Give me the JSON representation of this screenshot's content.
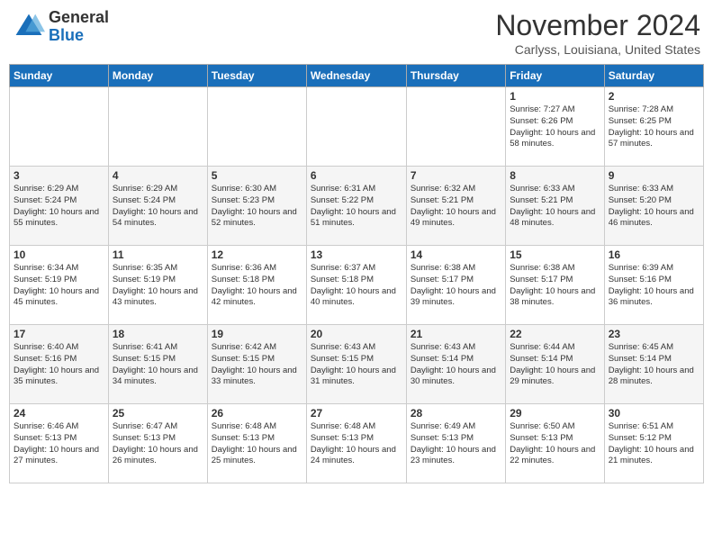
{
  "header": {
    "logo": {
      "line1": "General",
      "line2": "Blue"
    },
    "month": "November 2024",
    "location": "Carlyss, Louisiana, United States"
  },
  "weekdays": [
    "Sunday",
    "Monday",
    "Tuesday",
    "Wednesday",
    "Thursday",
    "Friday",
    "Saturday"
  ],
  "weeks": [
    [
      {
        "day": "",
        "info": ""
      },
      {
        "day": "",
        "info": ""
      },
      {
        "day": "",
        "info": ""
      },
      {
        "day": "",
        "info": ""
      },
      {
        "day": "",
        "info": ""
      },
      {
        "day": "1",
        "info": "Sunrise: 7:27 AM\nSunset: 6:26 PM\nDaylight: 10 hours and 58 minutes."
      },
      {
        "day": "2",
        "info": "Sunrise: 7:28 AM\nSunset: 6:25 PM\nDaylight: 10 hours and 57 minutes."
      }
    ],
    [
      {
        "day": "3",
        "info": "Sunrise: 6:29 AM\nSunset: 5:24 PM\nDaylight: 10 hours and 55 minutes."
      },
      {
        "day": "4",
        "info": "Sunrise: 6:29 AM\nSunset: 5:24 PM\nDaylight: 10 hours and 54 minutes."
      },
      {
        "day": "5",
        "info": "Sunrise: 6:30 AM\nSunset: 5:23 PM\nDaylight: 10 hours and 52 minutes."
      },
      {
        "day": "6",
        "info": "Sunrise: 6:31 AM\nSunset: 5:22 PM\nDaylight: 10 hours and 51 minutes."
      },
      {
        "day": "7",
        "info": "Sunrise: 6:32 AM\nSunset: 5:21 PM\nDaylight: 10 hours and 49 minutes."
      },
      {
        "day": "8",
        "info": "Sunrise: 6:33 AM\nSunset: 5:21 PM\nDaylight: 10 hours and 48 minutes."
      },
      {
        "day": "9",
        "info": "Sunrise: 6:33 AM\nSunset: 5:20 PM\nDaylight: 10 hours and 46 minutes."
      }
    ],
    [
      {
        "day": "10",
        "info": "Sunrise: 6:34 AM\nSunset: 5:19 PM\nDaylight: 10 hours and 45 minutes."
      },
      {
        "day": "11",
        "info": "Sunrise: 6:35 AM\nSunset: 5:19 PM\nDaylight: 10 hours and 43 minutes."
      },
      {
        "day": "12",
        "info": "Sunrise: 6:36 AM\nSunset: 5:18 PM\nDaylight: 10 hours and 42 minutes."
      },
      {
        "day": "13",
        "info": "Sunrise: 6:37 AM\nSunset: 5:18 PM\nDaylight: 10 hours and 40 minutes."
      },
      {
        "day": "14",
        "info": "Sunrise: 6:38 AM\nSunset: 5:17 PM\nDaylight: 10 hours and 39 minutes."
      },
      {
        "day": "15",
        "info": "Sunrise: 6:38 AM\nSunset: 5:17 PM\nDaylight: 10 hours and 38 minutes."
      },
      {
        "day": "16",
        "info": "Sunrise: 6:39 AM\nSunset: 5:16 PM\nDaylight: 10 hours and 36 minutes."
      }
    ],
    [
      {
        "day": "17",
        "info": "Sunrise: 6:40 AM\nSunset: 5:16 PM\nDaylight: 10 hours and 35 minutes."
      },
      {
        "day": "18",
        "info": "Sunrise: 6:41 AM\nSunset: 5:15 PM\nDaylight: 10 hours and 34 minutes."
      },
      {
        "day": "19",
        "info": "Sunrise: 6:42 AM\nSunset: 5:15 PM\nDaylight: 10 hours and 33 minutes."
      },
      {
        "day": "20",
        "info": "Sunrise: 6:43 AM\nSunset: 5:15 PM\nDaylight: 10 hours and 31 minutes."
      },
      {
        "day": "21",
        "info": "Sunrise: 6:43 AM\nSunset: 5:14 PM\nDaylight: 10 hours and 30 minutes."
      },
      {
        "day": "22",
        "info": "Sunrise: 6:44 AM\nSunset: 5:14 PM\nDaylight: 10 hours and 29 minutes."
      },
      {
        "day": "23",
        "info": "Sunrise: 6:45 AM\nSunset: 5:14 PM\nDaylight: 10 hours and 28 minutes."
      }
    ],
    [
      {
        "day": "24",
        "info": "Sunrise: 6:46 AM\nSunset: 5:13 PM\nDaylight: 10 hours and 27 minutes."
      },
      {
        "day": "25",
        "info": "Sunrise: 6:47 AM\nSunset: 5:13 PM\nDaylight: 10 hours and 26 minutes."
      },
      {
        "day": "26",
        "info": "Sunrise: 6:48 AM\nSunset: 5:13 PM\nDaylight: 10 hours and 25 minutes."
      },
      {
        "day": "27",
        "info": "Sunrise: 6:48 AM\nSunset: 5:13 PM\nDaylight: 10 hours and 24 minutes."
      },
      {
        "day": "28",
        "info": "Sunrise: 6:49 AM\nSunset: 5:13 PM\nDaylight: 10 hours and 23 minutes."
      },
      {
        "day": "29",
        "info": "Sunrise: 6:50 AM\nSunset: 5:13 PM\nDaylight: 10 hours and 22 minutes."
      },
      {
        "day": "30",
        "info": "Sunrise: 6:51 AM\nSunset: 5:12 PM\nDaylight: 10 hours and 21 minutes."
      }
    ]
  ]
}
